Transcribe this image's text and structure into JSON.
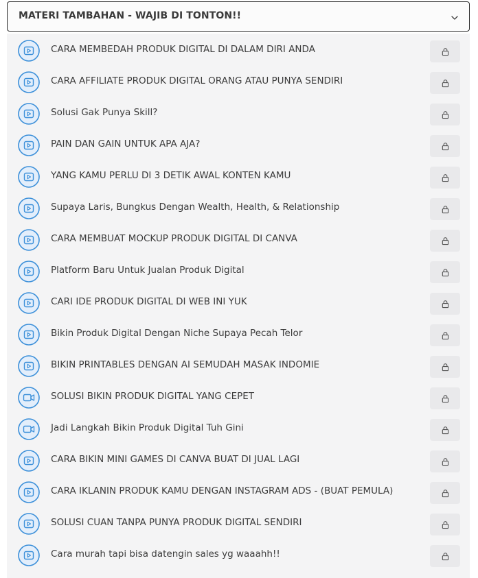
{
  "section": {
    "title": "MATERI TAMBAHAN - WAJIB DI TONTON!!",
    "toggle_icon": "chevron-down-icon"
  },
  "lessons": [
    {
      "title": "CARA MEMBEDAH PRODUK DIGITAL DI DALAM DIRI ANDA",
      "icon": "play-circle-icon",
      "locked": true
    },
    {
      "title": "CARA AFFILIATE PRODUK DIGITAL ORANG ATAU PUNYA SENDIRI",
      "icon": "play-circle-icon",
      "locked": true
    },
    {
      "title": "Solusi Gak Punya Skill?",
      "icon": "play-circle-icon",
      "locked": true
    },
    {
      "title": "PAIN DAN GAIN UNTUK APA AJA?",
      "icon": "play-circle-icon",
      "locked": true
    },
    {
      "title": "YANG KAMU PERLU DI 3 DETIK AWAL KONTEN KAMU",
      "icon": "play-circle-icon",
      "locked": true
    },
    {
      "title": "Supaya Laris, Bungkus Dengan Wealth, Health, & Relationship",
      "icon": "play-circle-icon",
      "locked": true
    },
    {
      "title": "CARA MEMBUAT MOCKUP PRODUK DIGITAL DI CANVA",
      "icon": "play-circle-icon",
      "locked": true
    },
    {
      "title": "Platform Baru Untuk Jualan Produk Digital",
      "icon": "play-circle-icon",
      "locked": true
    },
    {
      "title": "CARI IDE PRODUK DIGITAL DI WEB INI YUK",
      "icon": "play-circle-icon",
      "locked": true
    },
    {
      "title": "Bikin Produk Digital Dengan Niche Supaya Pecah Telor",
      "icon": "play-circle-icon",
      "locked": true
    },
    {
      "title": "BIKIN PRINTABLES DENGAN AI SEMUDAH MASAK INDOMIE",
      "icon": "play-circle-icon",
      "locked": true
    },
    {
      "title": "SOLUSI BIKIN PRODUK DIGITAL YANG CEPET",
      "icon": "video-camera-icon",
      "locked": true
    },
    {
      "title": "Jadi Langkah Bikin Produk Digital Tuh Gini",
      "icon": "video-camera-icon",
      "locked": true
    },
    {
      "title": "CARA BIKIN MINI GAMES DI CANVA BUAT DI JUAL LAGI",
      "icon": "play-circle-icon",
      "locked": true
    },
    {
      "title": "CARA IKLANIN PRODUK KAMU DENGAN INSTAGRAM ADS - (BUAT PEMULA)",
      "icon": "play-circle-icon",
      "locked": true
    },
    {
      "title": "SOLUSI CUAN TANPA PUNYA PRODUK DIGITAL SENDIRI",
      "icon": "play-circle-icon",
      "locked": true
    },
    {
      "title": "Cara murah tapi bisa datengin sales yg waaahh!!",
      "icon": "play-circle-icon",
      "locked": true
    }
  ],
  "colors": {
    "icon_blue": "#3b8fd9",
    "icon_fill": "#e3eefb",
    "lock_bg": "#e9e9eb",
    "panel_bg": "#f4f4f5"
  }
}
